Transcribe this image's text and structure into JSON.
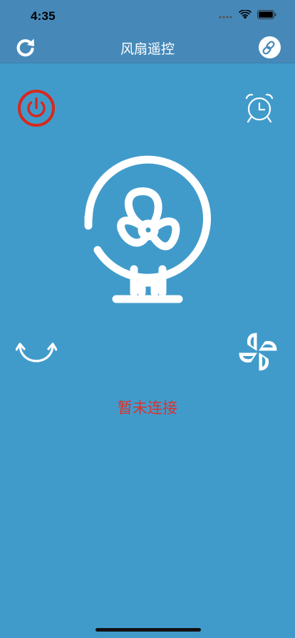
{
  "status_bar": {
    "time": "4:35"
  },
  "nav": {
    "title": "风扇遥控",
    "left_icon": "refresh-icon",
    "right_icon": "link-icon"
  },
  "controls": {
    "power_icon": "power-icon",
    "timer_icon": "alarm-clock-icon",
    "swing_icon": "swing-icon",
    "mode_icon": "pinwheel-icon"
  },
  "status": {
    "text": "暂未连接"
  },
  "colors": {
    "background": "#409bcb",
    "nav_bar": "#4689b9",
    "power": "#d8281c",
    "status_text": "#e0302a",
    "icon": "#ffffff"
  }
}
